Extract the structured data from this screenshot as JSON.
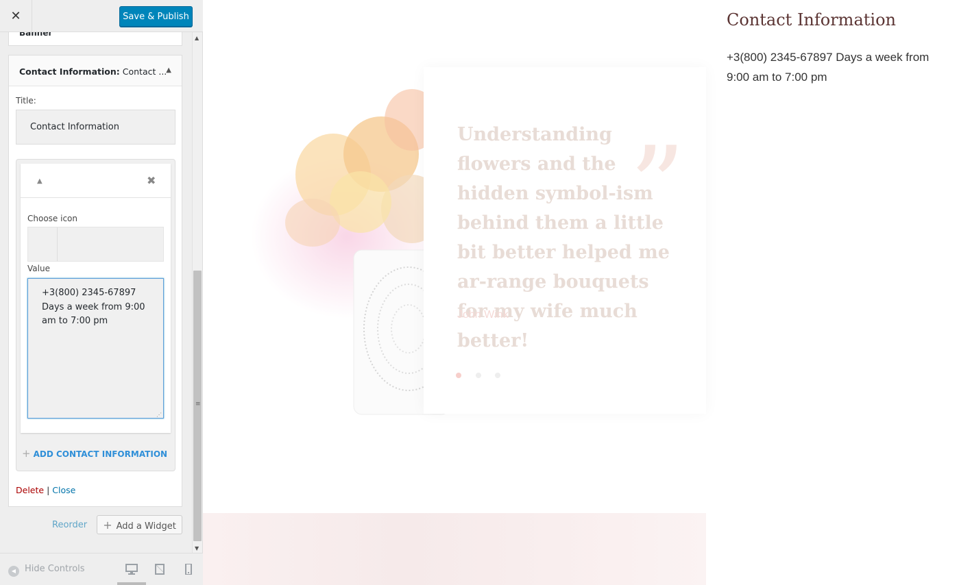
{
  "header": {
    "close_label": "✕",
    "save_label": "Save & Publish"
  },
  "widgets": {
    "collapsed_title": "Banner",
    "open_title_strong": "Contact Information:",
    "open_title_rest": "Contact ...",
    "title_label": "Title:",
    "title_value": "Contact Information",
    "item": {
      "choose_icon_label": "Choose icon",
      "value_label": "Value",
      "value_text": "+3(800) 2345-67897 Days a week from 9:00 am to 7:00 pm"
    },
    "add_contact_label": "ADD CONTACT INFORMATION",
    "delete_label": "Delete",
    "separator": "|",
    "close_label": "Close"
  },
  "panel": {
    "reorder_label": "Reorder",
    "add_widget_label": "Add a Widget"
  },
  "footer": {
    "hide_controls_label": "Hide Controls"
  },
  "preview": {
    "quote_text": "Understanding flowers and the hidden symbol-ism behind them a little bit better helped me ar-range bouquets for my wife much better!",
    "quote_author": "John Wink",
    "contact_title": "Contact Information",
    "contact_value": "+3(800) 2345-67897 Days a week from 9:00 am to 7:00 pm"
  },
  "colors": {
    "accent": "#0085ba",
    "link": "#0073aa",
    "delete": "#a00000",
    "heading": "#5b3433"
  }
}
